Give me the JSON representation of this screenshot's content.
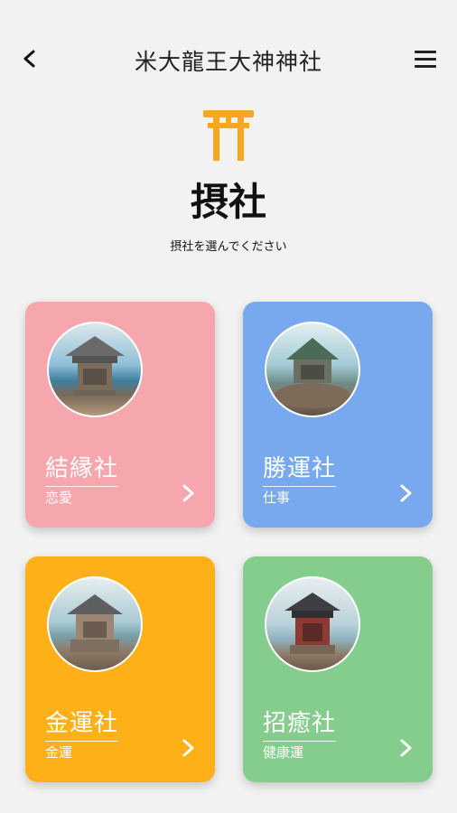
{
  "header": {
    "title": "米大龍王大神神社",
    "back_icon": "chevron-left-icon",
    "menu_icon": "hamburger-menu-icon"
  },
  "page": {
    "icon": "torii-gate-icon",
    "title": "摂社",
    "subtitle": "摂社を選んでください"
  },
  "shrines": [
    {
      "name": "結縁社",
      "benefit": "恋愛",
      "color": "#f6a7ad"
    },
    {
      "name": "勝運社",
      "benefit": "仕事",
      "color": "#78a9ee"
    },
    {
      "name": "金運社",
      "benefit": "金運",
      "color": "#fdb017"
    },
    {
      "name": "招癒社",
      "benefit": "健康運",
      "color": "#84cd8d"
    }
  ],
  "colors": {
    "accent": "#f6a81c",
    "background": "#f2f2f2",
    "text": "#111111"
  }
}
